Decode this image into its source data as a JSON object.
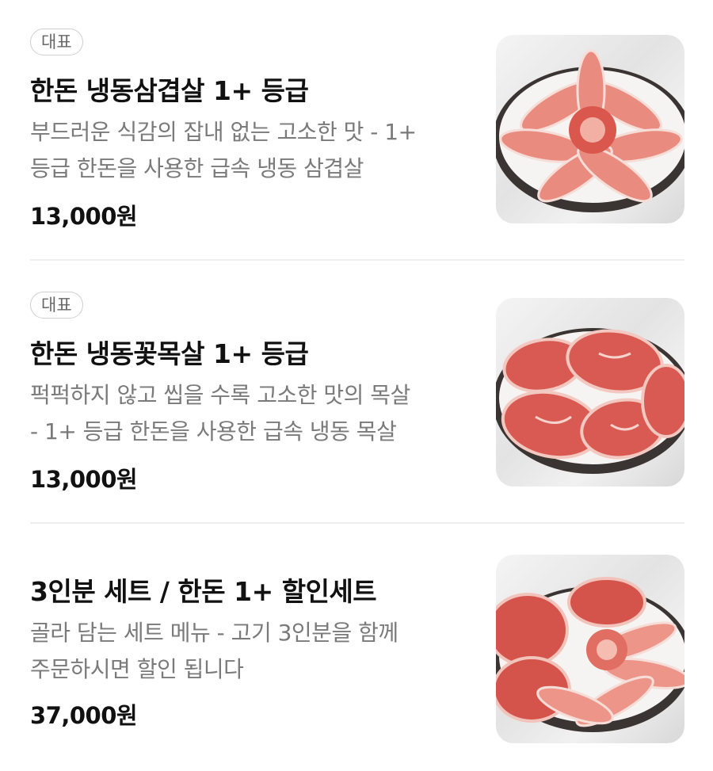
{
  "items": [
    {
      "badge": "대표",
      "name": "한돈 냉동삼겹살 1+ 등급",
      "desc_line1": "부드러운 식감의 잡내 없는 고소한 맛 - 1+",
      "desc_line2": "등급 한돈을 사용한 급속 냉동 삼겹살",
      "price": "13,000원",
      "image_icon": "pork-belly-plate-image"
    },
    {
      "badge": "대표",
      "name": "한돈 냉동꽃목살 1+ 등급",
      "desc_line1": "퍽퍽하지 않고 씹을 수록 고소한 맛의 목살",
      "desc_line2": "- 1+ 등급 한돈을 사용한 급속 냉동 목살",
      "price": "13,000원",
      "image_icon": "pork-neck-plate-image"
    },
    {
      "name": "3인분 세트 / 한돈 1+ 할인세트",
      "desc_line1": "골라 담는 세트 메뉴 - 고기 3인분을 함께",
      "desc_line2": "주문하시면 할인 됩니다",
      "price": "37,000원",
      "image_icon": "pork-set-plate-image"
    }
  ]
}
